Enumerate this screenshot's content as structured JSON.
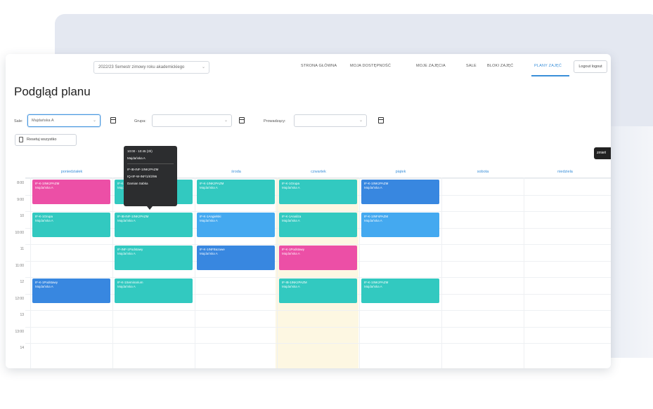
{
  "header": {
    "academic_year": "2022/23 Semestr zimowy roku akademickiego",
    "academic_year_chevron": "⌄",
    "nav": [
      {
        "label": "STRONA GŁÓWNA",
        "active": false
      },
      {
        "label": "MOJA DOSTĘPNOŚĆ",
        "active": false
      },
      {
        "label": "MOJE ZAJĘCIA",
        "active": false
      },
      {
        "label": "SALE",
        "active": false
      },
      {
        "label": "BLOKI ZAJĘĆ",
        "active": false
      },
      {
        "label": "PLANY ZAJĘĆ",
        "active": true
      }
    ],
    "logout_label": "Logout logout",
    "accent_color": "#3a8fd9"
  },
  "page": {
    "title": "Podgląd planu"
  },
  "filters": {
    "room_label": "Sale:",
    "room_value": "Majdańska A",
    "group_label": "Grupa:",
    "group_value": "",
    "teacher_label": "Prowadzący:",
    "teacher_value": "",
    "chevron": "⌄",
    "clear_label": "Resetuj wszystko",
    "side_button": "zmień"
  },
  "calendar": {
    "days": [
      "poniedziałek",
      "wtorek",
      "środa",
      "czwartek",
      "piątek",
      "sobota",
      "niedziela"
    ],
    "times": [
      "8:00",
      "9:00",
      "10",
      "10:00",
      "11",
      "11:00",
      "12",
      "12:00",
      "13",
      "13:00",
      "14"
    ],
    "events": [
      {
        "day": 0,
        "row": 0,
        "color": "pink",
        "line1": "IF-K-1INKzPAZM",
        "line2": "Majdańska A"
      },
      {
        "day": 1,
        "row": 0,
        "color": "teal",
        "line1": "IF-K-",
        "line2": "Majd"
      },
      {
        "day": 2,
        "row": 0,
        "color": "teal",
        "line1": "IF-K-1INKzPAZM",
        "line2": "Majdańska A"
      },
      {
        "day": 3,
        "row": 0,
        "color": "teal",
        "line1": "IF-K-1Grupa",
        "line2": "Majdańska A"
      },
      {
        "day": 4,
        "row": 0,
        "color": "blue",
        "line1": "IF-K-1INKzPAZM",
        "line2": "Majdańska A"
      },
      {
        "day": 0,
        "row": 1,
        "color": "teal",
        "line1": "IF-K-1Grupa",
        "line2": "Majdańska A"
      },
      {
        "day": 1,
        "row": 1,
        "color": "teal",
        "line1": "IF-IB-INF-1INKzPAZM",
        "line2": "Majdańska A"
      },
      {
        "day": 2,
        "row": 1,
        "color": "sky",
        "line1": "IF-K-1Angielski",
        "line2": "Majdańska A"
      },
      {
        "day": 3,
        "row": 1,
        "color": "teal",
        "line1": "IF-K-1Analiza",
        "line2": "Majdańska A"
      },
      {
        "day": 4,
        "row": 1,
        "color": "sky",
        "line1": "IF-K-1INFsPAZM",
        "line2": "Majdańska A"
      },
      {
        "day": 1,
        "row": 2,
        "color": "teal",
        "line1": "IF-INF-1Podstawy",
        "line2": "Majdańska A"
      },
      {
        "day": 2,
        "row": 2,
        "color": "blue",
        "line1": "IF-K-1INFBazawe",
        "line2": "Majdańska A"
      },
      {
        "day": 3,
        "row": 2,
        "color": "pink",
        "line1": "IF-K-1Podstawy",
        "line2": "Majdańska A"
      },
      {
        "day": 0,
        "row": 3,
        "color": "blue",
        "line1": "IF-K-1Podstawy",
        "line2": "Majdańska A"
      },
      {
        "day": 1,
        "row": 3,
        "color": "teal",
        "line1": "IF-K-1Seminarium",
        "line2": "Majdańska A"
      },
      {
        "day": 3,
        "row": 3,
        "color": "teal",
        "line1": "IF-IB-1INKzPAZM",
        "line2": "Majdańska A"
      },
      {
        "day": 4,
        "row": 3,
        "color": "teal",
        "line1": "IF-K-1INKzPAZM",
        "line2": "Majdańska A"
      }
    ],
    "tooltip": {
      "time": "10:00 - 10:45 (3h)",
      "room": "Majdańska A",
      "group": "IF-IB-INF-1INKzPAZM",
      "course": "IQ-IIF-W-INF/1/I/2/96",
      "teacher": "Damian Sabka"
    },
    "colors": {
      "teal": "#32c9c0",
      "pink": "#ec4fa6",
      "blue": "#3887e0",
      "sky": "#44a9f0",
      "today": "#fdf7e2"
    }
  }
}
